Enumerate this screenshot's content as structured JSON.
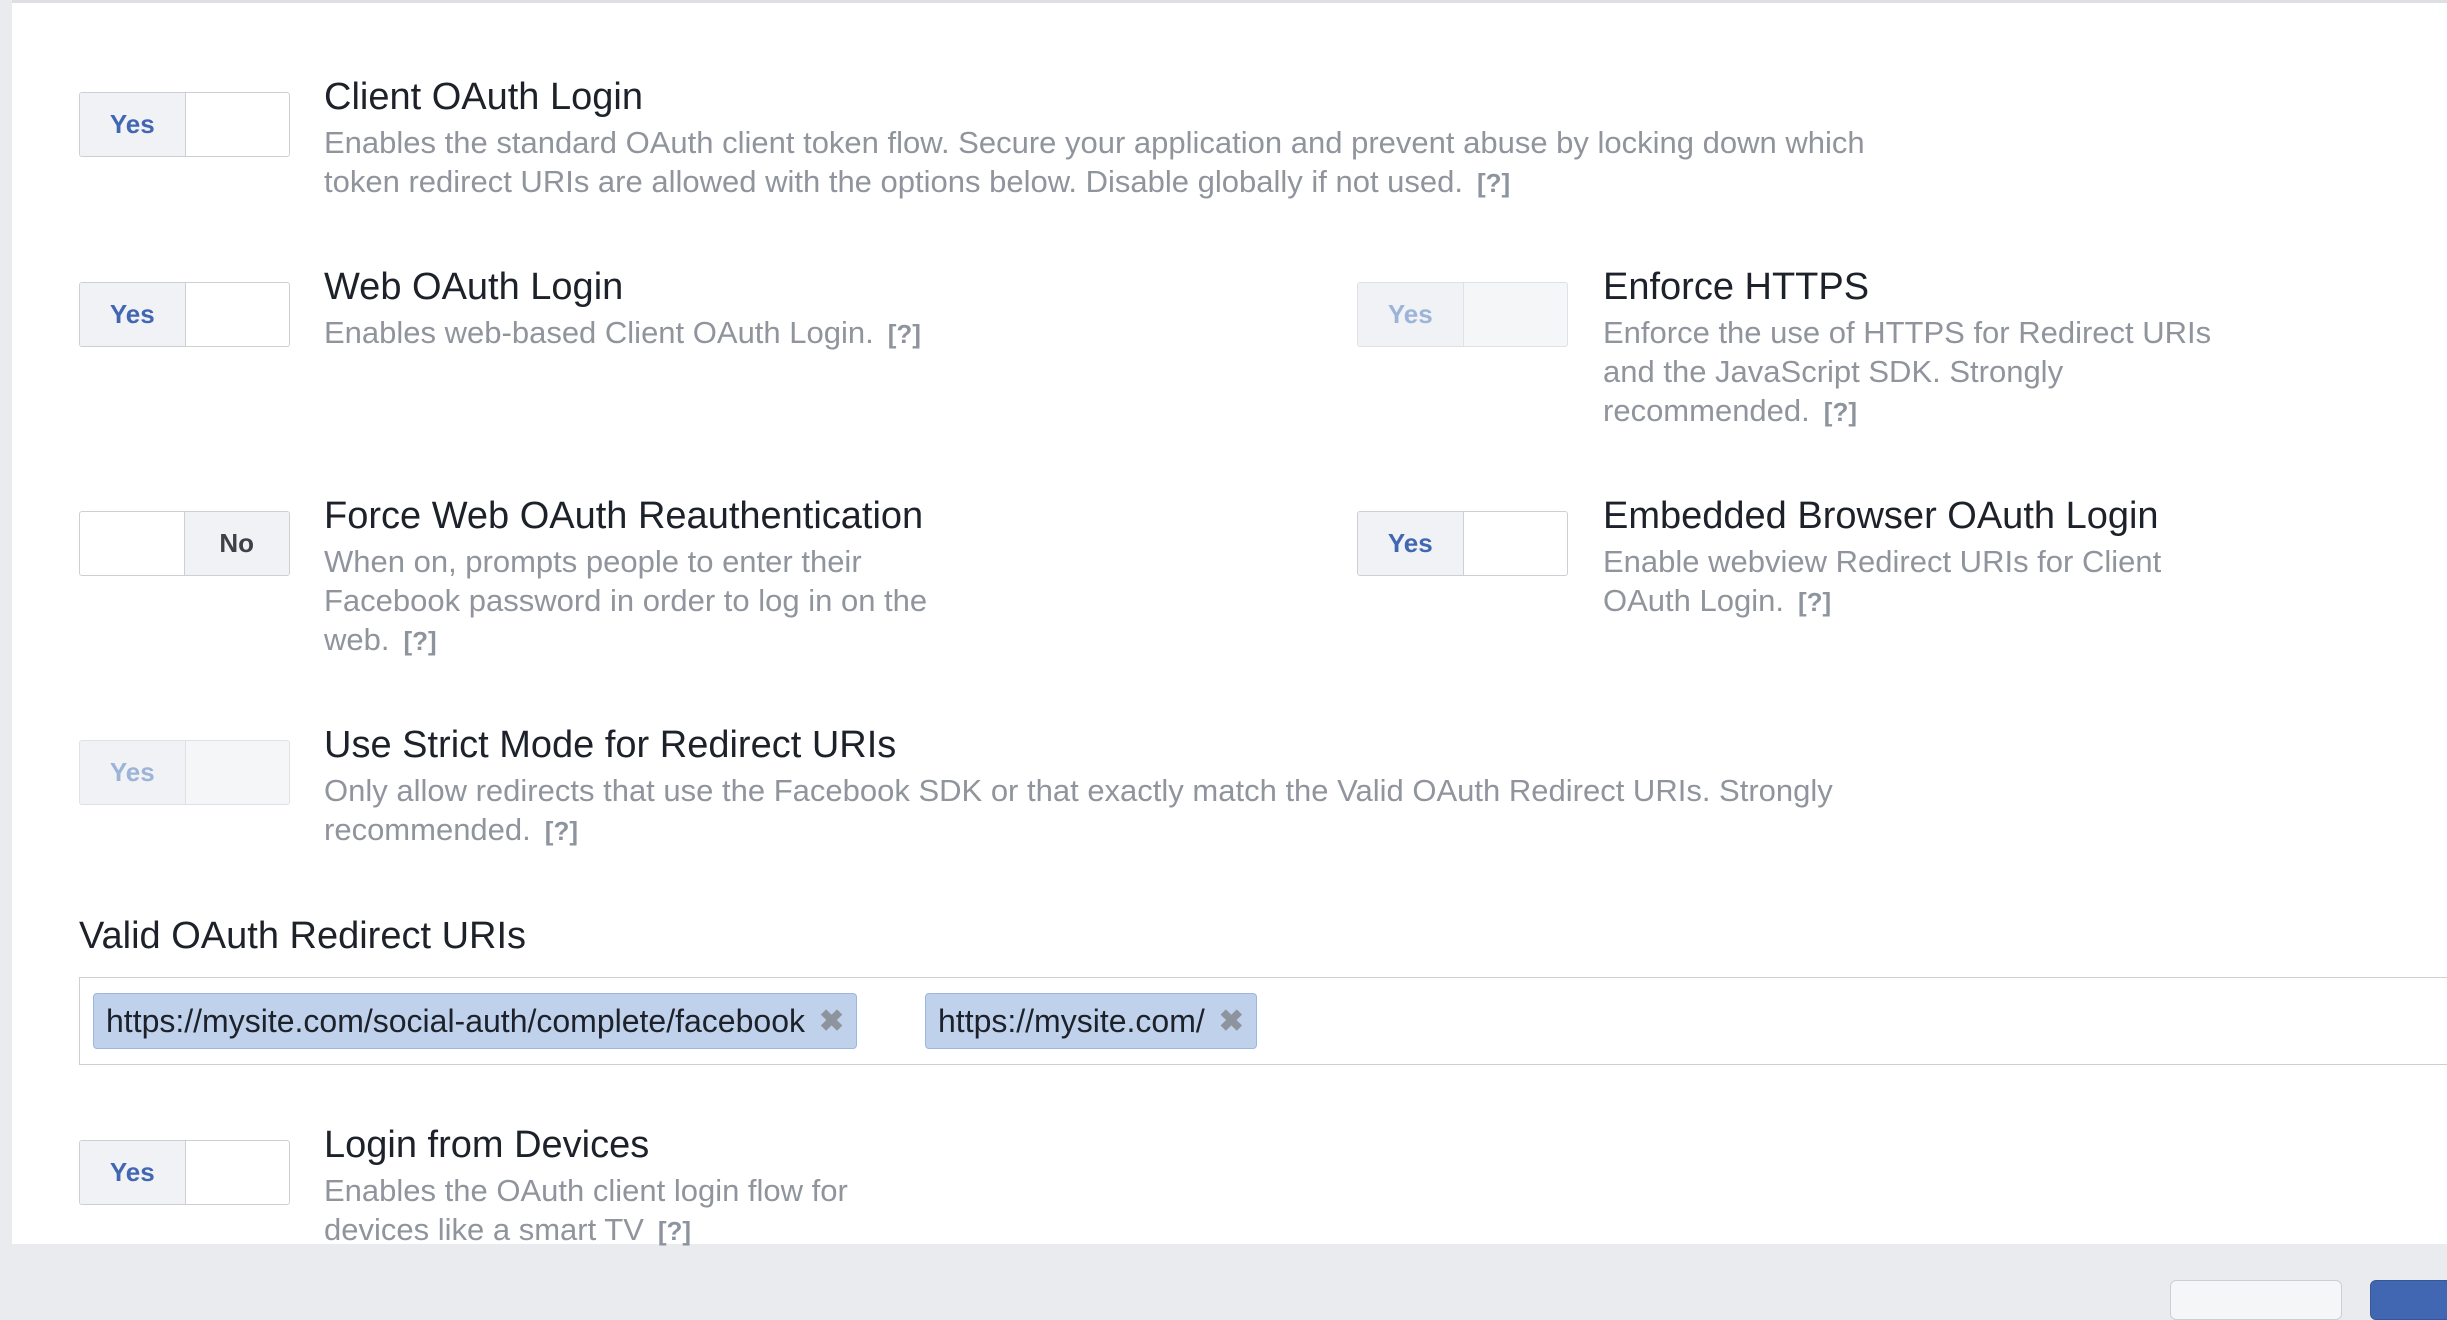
{
  "settings": {
    "client_oauth": {
      "title": "Client OAuth Login",
      "desc": "Enables the standard OAuth client token flow. Secure your application and prevent abuse by locking down which token redirect URIs are allowed with the options below. Disable globally if not used.",
      "toggle": "Yes"
    },
    "web_oauth": {
      "title": "Web OAuth Login",
      "desc": "Enables web-based Client OAuth Login.",
      "toggle": "Yes"
    },
    "enforce_https": {
      "title": "Enforce HTTPS",
      "desc": "Enforce the use of HTTPS for Redirect URIs and the JavaScript SDK. Strongly recommended.",
      "toggle": "Yes"
    },
    "force_reauth": {
      "title": "Force Web OAuth Reauthentication",
      "desc": "When on, prompts people to enter their Facebook password in order to log in on the web.",
      "toggle": "No"
    },
    "embedded_browser": {
      "title": "Embedded Browser OAuth Login",
      "desc": "Enable webview Redirect URIs for Client OAuth Login.",
      "toggle": "Yes"
    },
    "strict_mode": {
      "title": "Use Strict Mode for Redirect URIs",
      "desc": "Only allow redirects that use the Facebook SDK or that exactly match the Valid OAuth Redirect URIs. Strongly recommended.",
      "toggle": "Yes"
    },
    "login_devices": {
      "title": "Login from Devices",
      "desc": "Enables the OAuth client login flow for devices like a smart TV",
      "toggle": "Yes"
    }
  },
  "help_label": "[?]",
  "redirect_uris": {
    "label": "Valid OAuth Redirect URIs",
    "items": [
      "https://mysite.com/social-auth/complete/facebook",
      "https://mysite.com/"
    ],
    "remove_glyph": "✖"
  }
}
